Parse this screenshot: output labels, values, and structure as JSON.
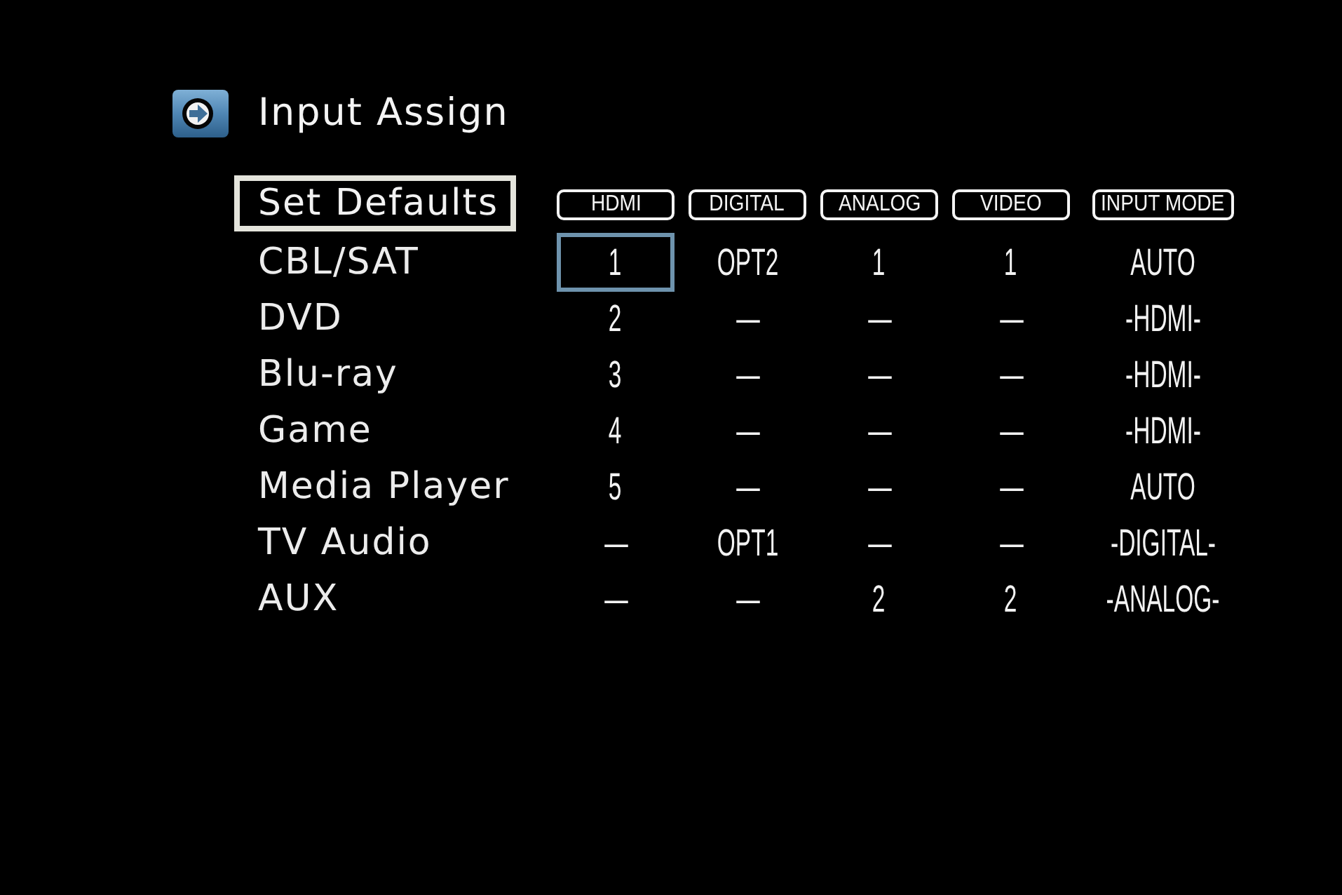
{
  "header": {
    "title": "Input Assign"
  },
  "set_defaults_button": {
    "label": "Set Defaults"
  },
  "table": {
    "columns": [
      "HDMI",
      "DIGITAL",
      "ANALOG",
      "VIDEO",
      "INPUT MODE"
    ],
    "rows": [
      {
        "source": "CBL/SAT",
        "cells": [
          {
            "text": "1",
            "selected": true
          },
          {
            "text": "OPT2",
            "selected": false
          },
          {
            "text": "1",
            "selected": false
          },
          {
            "text": "1",
            "selected": false
          },
          {
            "text": "AUTO",
            "selected": false
          }
        ]
      },
      {
        "source": "DVD",
        "cells": [
          {
            "text": "2",
            "selected": false
          },
          {
            "text": "—",
            "selected": false
          },
          {
            "text": "—",
            "selected": false
          },
          {
            "text": "—",
            "selected": false
          },
          {
            "text": "-HDMI-",
            "selected": false
          }
        ]
      },
      {
        "source": "Blu-ray",
        "cells": [
          {
            "text": "3",
            "selected": false
          },
          {
            "text": "—",
            "selected": false
          },
          {
            "text": "—",
            "selected": false
          },
          {
            "text": "—",
            "selected": false
          },
          {
            "text": "-HDMI-",
            "selected": false
          }
        ]
      },
      {
        "source": "Game",
        "cells": [
          {
            "text": "4",
            "selected": false
          },
          {
            "text": "—",
            "selected": false
          },
          {
            "text": "—",
            "selected": false
          },
          {
            "text": "—",
            "selected": false
          },
          {
            "text": "-HDMI-",
            "selected": false
          }
        ]
      },
      {
        "source": "Media Player",
        "cells": [
          {
            "text": "5",
            "selected": false
          },
          {
            "text": "—",
            "selected": false
          },
          {
            "text": "—",
            "selected": false
          },
          {
            "text": "—",
            "selected": false
          },
          {
            "text": "AUTO",
            "selected": false
          }
        ]
      },
      {
        "source": "TV Audio",
        "cells": [
          {
            "text": "—",
            "selected": false
          },
          {
            "text": "OPT1",
            "selected": false
          },
          {
            "text": "—",
            "selected": false
          },
          {
            "text": "—",
            "selected": false
          },
          {
            "text": "-DIGITAL-",
            "selected": false
          }
        ]
      },
      {
        "source": "AUX",
        "cells": [
          {
            "text": "—",
            "selected": false
          },
          {
            "text": "—",
            "selected": false
          },
          {
            "text": "2",
            "selected": false
          },
          {
            "text": "2",
            "selected": false
          },
          {
            "text": "-ANALOG-",
            "selected": false
          }
        ]
      }
    ]
  }
}
